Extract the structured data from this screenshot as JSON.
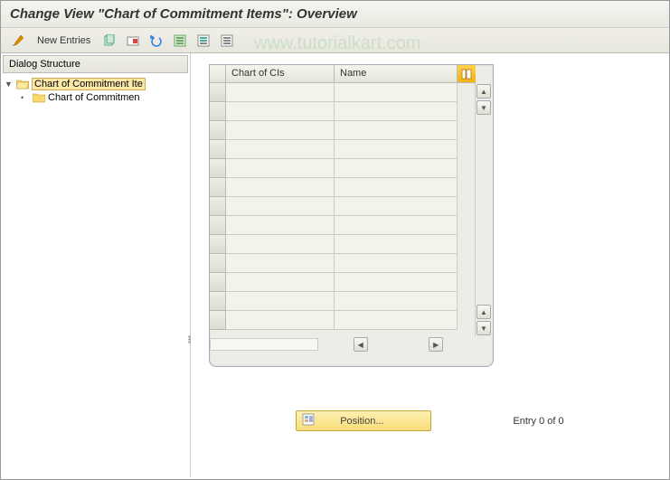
{
  "title": "Change View \"Chart of Commitment Items\": Overview",
  "toolbar": {
    "new_entries": "New Entries"
  },
  "watermark": "www.tutorialkart.com",
  "sidebar": {
    "header": "Dialog Structure",
    "items": [
      {
        "label": "Chart of Commitment Ite",
        "selected": true,
        "expanded": true
      },
      {
        "label": "Chart of Commitmen",
        "selected": false,
        "expanded": false
      }
    ]
  },
  "grid": {
    "columns": [
      "Chart of CIs",
      "Name"
    ],
    "row_count": 13
  },
  "footer": {
    "position_label": "Position...",
    "entry_text": "Entry 0 of 0"
  }
}
